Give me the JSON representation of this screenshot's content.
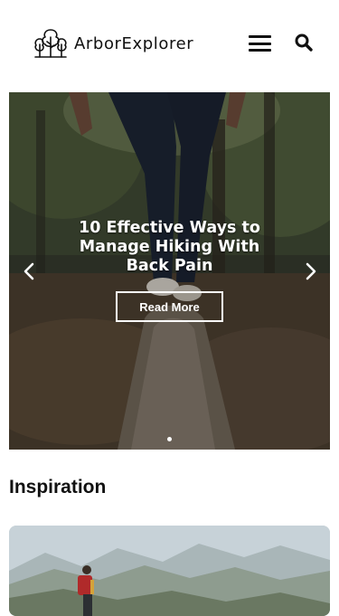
{
  "header": {
    "logo_text": "ArborExplorer",
    "logo_icon": "trees-logo-icon",
    "menu_icon": "hamburger-menu-icon",
    "search_icon": "search-icon"
  },
  "hero": {
    "title": "10 Effective Ways to Manage Hiking With Back Pain",
    "button_label": "Read More",
    "prev_icon": "chevron-left-icon",
    "next_icon": "chevron-right-icon",
    "slides_count": 1,
    "active_slide": 1
  },
  "sections": {
    "inspiration_title": "Inspiration"
  },
  "colors": {
    "text": "#111111",
    "background": "#ffffff",
    "hero_text": "#ffffff"
  }
}
